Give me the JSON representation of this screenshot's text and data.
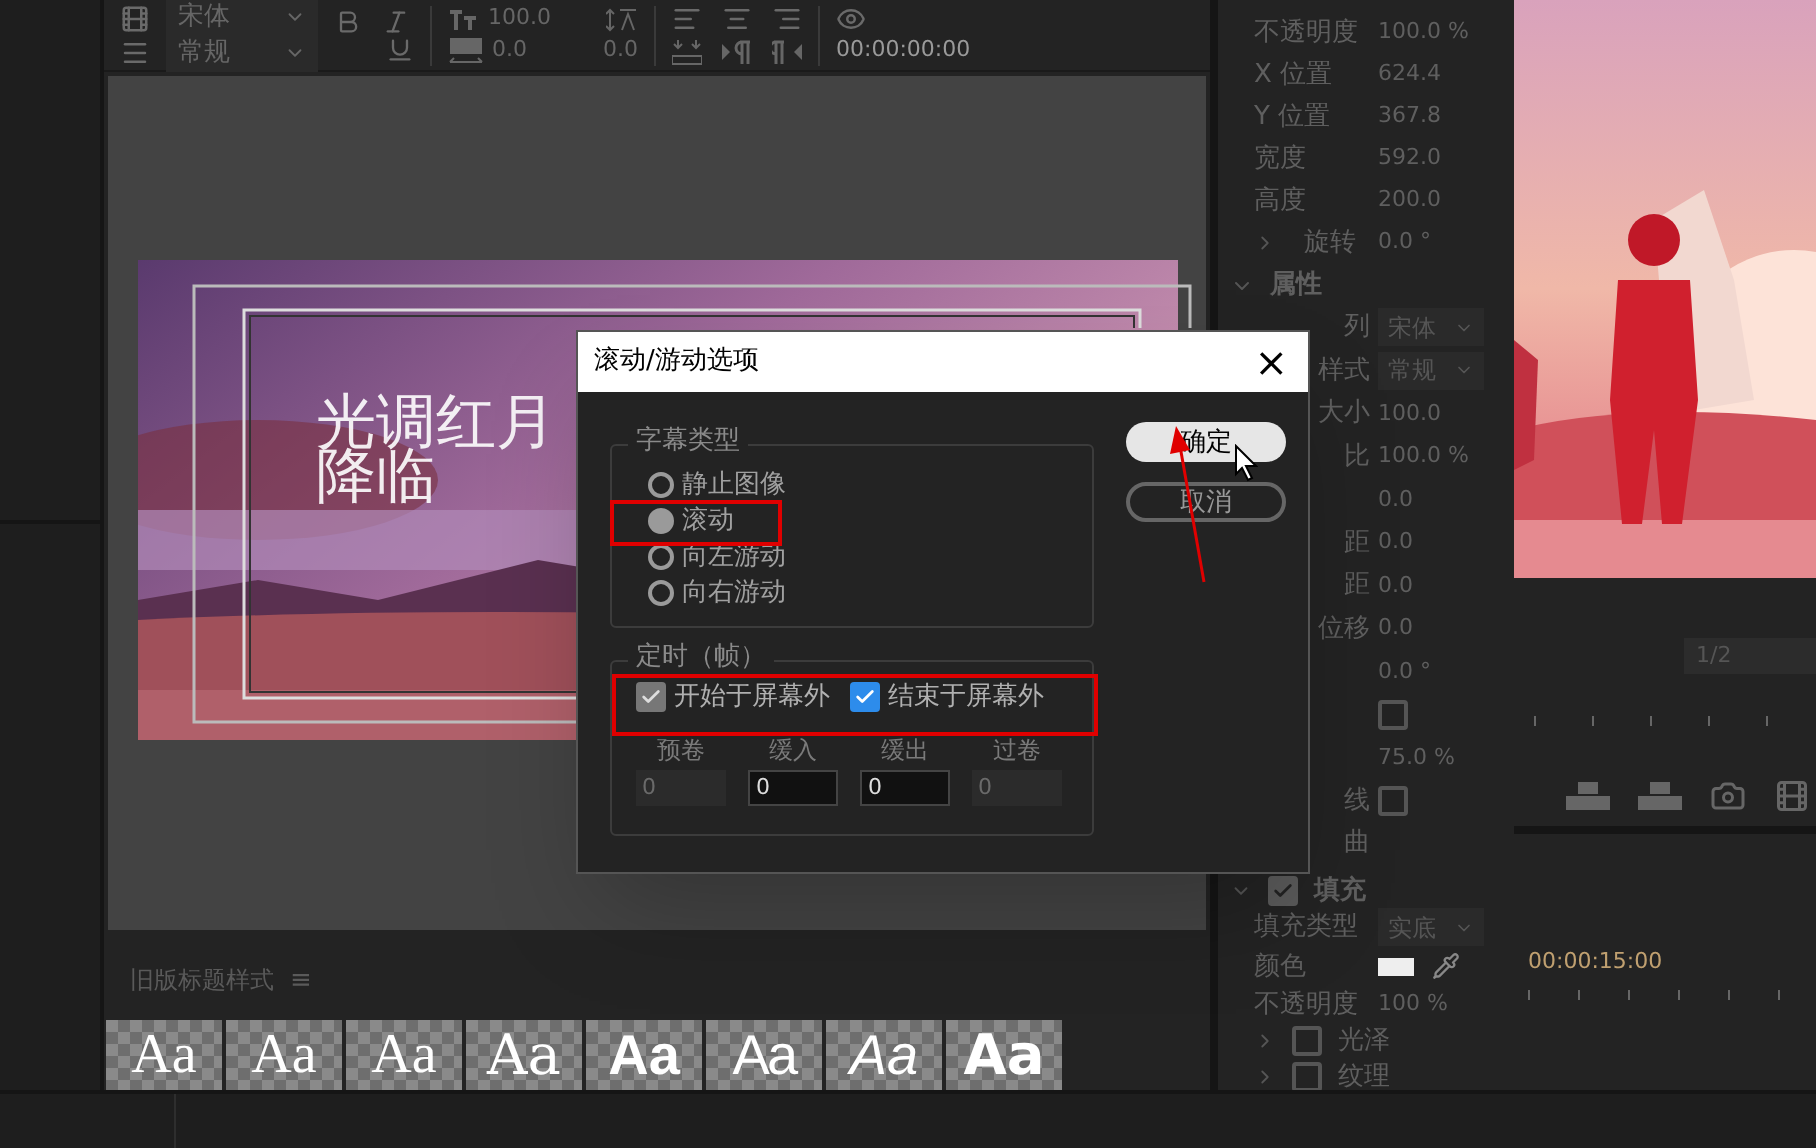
{
  "toolbar": {
    "font_family": "宋体",
    "font_style": "常规",
    "font_size": "100.0",
    "kerning": "0.0",
    "tracking": "0.0",
    "timecode": "00:00:00:00"
  },
  "canvas": {
    "title_lines": [
      "光调红月",
      "降临"
    ]
  },
  "styles_panel": {
    "title": "旧版标题样式",
    "menu": "≡",
    "swatches": [
      {
        "label": "Aa",
        "kind": "serif"
      },
      {
        "label": "Aa",
        "kind": "serif"
      },
      {
        "label": "Aa",
        "kind": "serif"
      },
      {
        "label": "Aa",
        "kind": "thin"
      },
      {
        "label": "Aa",
        "kind": "bold"
      },
      {
        "label": "Aa",
        "kind": "condensed"
      },
      {
        "label": "Aa",
        "kind": "italic"
      },
      {
        "label": "Aa",
        "kind": "black"
      }
    ]
  },
  "properties": {
    "rows_above": [
      {
        "kind": "value",
        "label": "不透明度",
        "value": "100.0 %"
      },
      {
        "kind": "value",
        "label": "X 位置",
        "value": "624.4"
      },
      {
        "kind": "value",
        "label": "Y 位置",
        "value": "367.8"
      },
      {
        "kind": "value",
        "label": "宽度",
        "value": "592.0"
      },
      {
        "kind": "value",
        "label": "高度",
        "value": "200.0"
      },
      {
        "kind": "expander",
        "label": "旋转",
        "value": "0.0 °",
        "expanded": false
      },
      {
        "kind": "section",
        "label": "属性",
        "expanded": true
      }
    ],
    "rows_beside": [
      {
        "kind": "dropdown",
        "label": "列",
        "value": "宋体"
      },
      {
        "kind": "dropdown",
        "label": "样式",
        "value": "常规"
      },
      {
        "kind": "value",
        "label": "大小",
        "value": "100.0"
      },
      {
        "kind": "value",
        "label": "比",
        "value": "100.0 %"
      },
      {
        "kind": "value",
        "value": "0.0"
      },
      {
        "kind": "value",
        "label": "距",
        "value": "0.0"
      },
      {
        "kind": "value",
        "label": "距",
        "value": "0.0"
      },
      {
        "kind": "value",
        "label": "位移",
        "value": "0.0"
      },
      {
        "kind": "value",
        "value": "0.0 °"
      },
      {
        "kind": "checkbox",
        "checked": false
      },
      {
        "kind": "value",
        "value": "75.0 %"
      },
      {
        "kind": "checkbox",
        "label": "线",
        "checked": false
      },
      {
        "kind": "value",
        "label": "曲"
      }
    ],
    "rows_below": [
      {
        "kind": "section_check",
        "label": "填充",
        "expanded": true,
        "checked": true
      },
      {
        "kind": "dropdown",
        "label": "填充类型",
        "value": "实底"
      },
      {
        "kind": "color",
        "label": "颜色",
        "color": "#eeeeee"
      },
      {
        "kind": "value",
        "label": "不透明度",
        "value": "100 %"
      },
      {
        "kind": "expander_check",
        "label": "光泽",
        "expanded": false,
        "checked": false
      },
      {
        "kind": "expander_check",
        "label": "纹理",
        "expanded": false,
        "checked": false
      }
    ]
  },
  "monitor": {
    "zoom": "1/2"
  },
  "timeline": {
    "timecode": "00:00:15:00"
  },
  "dialog": {
    "title": "滚动/游动选项",
    "close": "×",
    "type_group": {
      "legend": "字幕类型",
      "options": [
        {
          "label": "静止图像",
          "selected": false
        },
        {
          "label": "滚动",
          "selected": true
        },
        {
          "label": "向左游动",
          "selected": false
        },
        {
          "label": "向右游动",
          "selected": false
        }
      ]
    },
    "buttons": [
      {
        "label": "确定",
        "primary": true
      },
      {
        "label": "取消",
        "primary": false
      }
    ],
    "timing_group": {
      "legend": "定时（帧）",
      "checkboxes": [
        {
          "label": "开始于屏幕外",
          "checked": true,
          "disabled": true
        },
        {
          "label": "结束于屏幕外",
          "checked": true,
          "disabled": false
        }
      ],
      "fields": [
        {
          "label": "预卷",
          "value": "0",
          "disabled": true
        },
        {
          "label": "缓入",
          "value": "0",
          "disabled": false
        },
        {
          "label": "缓出",
          "value": "0",
          "disabled": false
        },
        {
          "label": "过卷",
          "value": "0",
          "disabled": true
        }
      ]
    }
  }
}
